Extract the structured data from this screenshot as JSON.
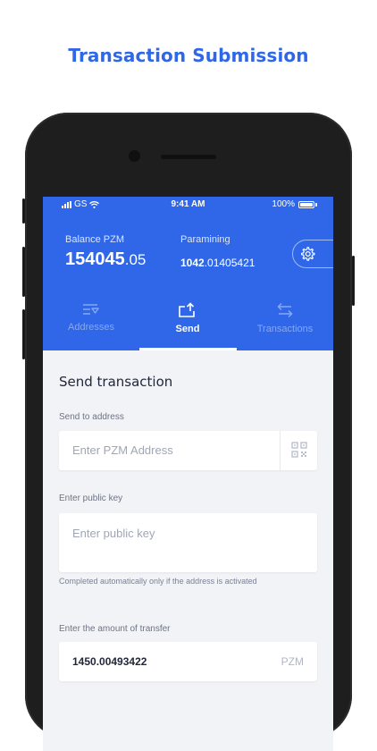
{
  "headline": "Transaction Submission",
  "status_bar": {
    "carrier": "GS",
    "time": "9:41 AM",
    "battery": "100%"
  },
  "balance": {
    "label": "Balance PZM",
    "integer": "154045",
    "fraction": ".05"
  },
  "paramining": {
    "label": "Paramining",
    "integer": "1042",
    "fraction": ".01405421"
  },
  "tabs": [
    {
      "label": "Addresses",
      "icon": "list-filter-icon",
      "active": false
    },
    {
      "label": "Send",
      "icon": "send-upload-icon",
      "active": true
    },
    {
      "label": "Transactions",
      "icon": "swap-arrows-icon",
      "active": false
    }
  ],
  "form": {
    "title": "Send transaction",
    "address": {
      "label": "Send to address",
      "placeholder": "Enter PZM Address",
      "icon": "qr-code-icon"
    },
    "public_key": {
      "label": "Enter public key",
      "placeholder": "Enter public key",
      "hint": "Completed automatically only if the address is activated"
    },
    "amount": {
      "label": "Enter the amount of transfer",
      "value": "1450.00493422",
      "unit": "PZM"
    }
  },
  "colors": {
    "primary": "#2f67e8",
    "background": "#f2f3f7",
    "text_dark": "#22283a"
  }
}
